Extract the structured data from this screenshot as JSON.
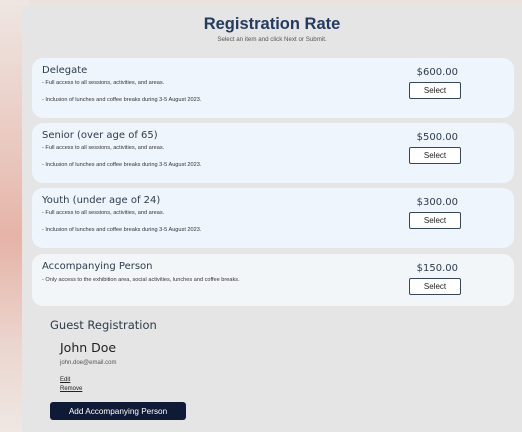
{
  "header": {
    "title": "Registration Rate",
    "subtitle": "Select an item and click Next or Submit."
  },
  "rates": [
    {
      "name": "Delegate",
      "lines": [
        "- Full access to all sessions, activities, and areas.",
        "- Inclusion of lunches and coffee breaks during 3-5 August 2023."
      ],
      "price": "$600.00",
      "button": "Select"
    },
    {
      "name": "Senior (over age of 65)",
      "lines": [
        "- Full access to all sessions, activities, and areas.",
        "- Inclusion of lunches and coffee breaks during 3-5 August 2023."
      ],
      "price": "$500.00",
      "button": "Select"
    },
    {
      "name": "Youth (under age of 24)",
      "lines": [
        "- Full access to all sessions, activities, and areas.",
        "- Inclusion of lunches and coffee breaks during 3-5 August 2023."
      ],
      "price": "$300.00",
      "button": "Select"
    },
    {
      "name": "Accompanying Person",
      "lines": [
        "- Only access to the exhibition area, social activities, lunches and coffee breaks."
      ],
      "price": "$150.00",
      "button": "Select"
    }
  ],
  "guest": {
    "heading": "Guest Registration",
    "name": "John Doe",
    "email": "john.doe@email.com",
    "edit_label": "Edit",
    "remove_label": "Remove",
    "add_button": "Add Accompanying Person"
  },
  "colors": {
    "title": "#243a5e",
    "card_bg": "#eef5fc",
    "panel_bg": "#e5e5e5",
    "add_button_bg": "#0f1b36"
  }
}
